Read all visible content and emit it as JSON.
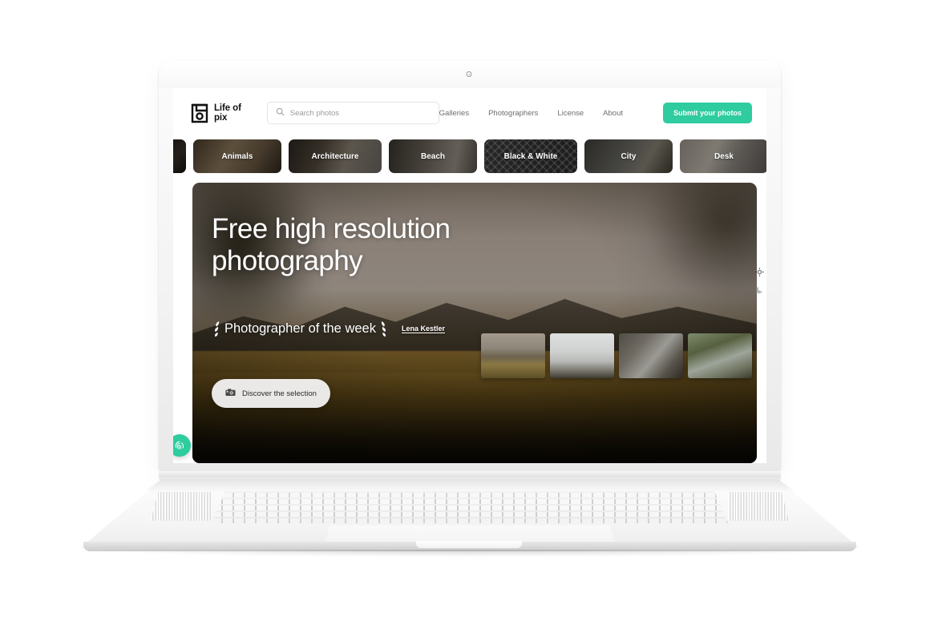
{
  "colors": {
    "accent": "#2ecc9e",
    "text_dark": "#111111",
    "text_muted": "#6e6e6e"
  },
  "brand": {
    "name": "Life of pix",
    "logo_icon": "camera-logo-icon"
  },
  "search": {
    "placeholder": "Search photos",
    "value": "",
    "icon": "search-icon"
  },
  "nav": {
    "items": [
      {
        "label": "Galleries"
      },
      {
        "label": "Photographers"
      },
      {
        "label": "License"
      },
      {
        "label": "About"
      }
    ],
    "cta_label": "Submit your photos"
  },
  "categories": {
    "items": [
      {
        "label": "",
        "partial": true
      },
      {
        "label": "Animals"
      },
      {
        "label": "Architecture"
      },
      {
        "label": "Beach"
      },
      {
        "label": "Black & White"
      },
      {
        "label": "City"
      },
      {
        "label": "Desk"
      },
      {
        "label": "",
        "partial": true
      }
    ]
  },
  "hero": {
    "title_line1": "Free high resolution",
    "title_line2": "photography",
    "photographer_of_week_label": "Photographer of the week",
    "photographer_name": "Lena Kestler",
    "discover_label": "Discover the selection",
    "discover_icon": "camera-icon",
    "laurel_icon": "laurel-wreath-icon",
    "thumbnails": [
      {
        "name": "thumbnail-golden-field-mountains"
      },
      {
        "name": "thumbnail-snowy-dolomites"
      },
      {
        "name": "thumbnail-rocky-cliff"
      },
      {
        "name": "thumbnail-caravan-forest"
      }
    ]
  },
  "theme_switch": {
    "light_icon": "sun-icon",
    "dark_icon": "moon-icon"
  },
  "badge": {
    "icon": "fingerprint-icon"
  }
}
